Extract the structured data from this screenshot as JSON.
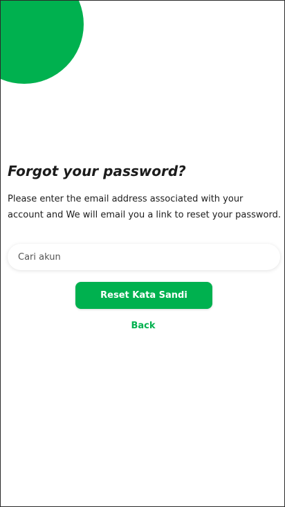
{
  "forgot_password": {
    "title": "Forgot your password?",
    "description": "Please enter the email address associated with your account and We will email you a link to reset your password.",
    "account_input": {
      "placeholder": "Cari akun",
      "value": ""
    },
    "reset_button_label": "Reset Kata Sandi",
    "back_link_label": "Back"
  },
  "theme": {
    "accent": "#00b14f",
    "text": "#1c1c1c",
    "background": "#ffffff"
  }
}
